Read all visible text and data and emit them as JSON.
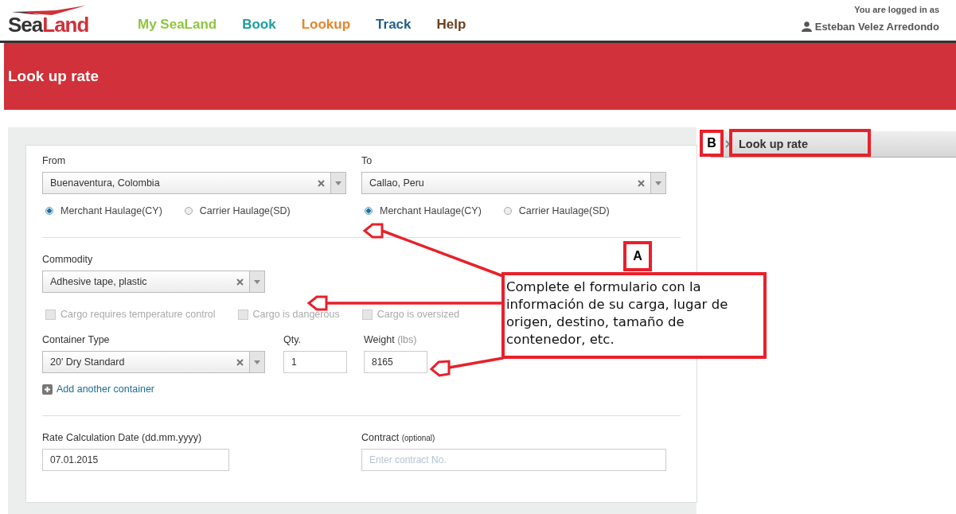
{
  "header": {
    "logo": {
      "part_1": "Sea",
      "part_2": "Land"
    },
    "nav": [
      {
        "label": "My SeaLand",
        "color": "#8dc63f"
      },
      {
        "label": "Book",
        "color": "#1a9e9e"
      },
      {
        "label": "Lookup",
        "color": "#e8822a"
      },
      {
        "label": "Track",
        "color": "#1f5f86"
      },
      {
        "label": "Help",
        "color": "#6b3e1e"
      }
    ],
    "login_caption": "You are logged in as",
    "user_name": "Esteban Velez Arredondo"
  },
  "banner": {
    "title": "Look up rate"
  },
  "form": {
    "from": {
      "label": "From",
      "value": "Buenaventura, Colombia",
      "haulage": [
        {
          "label": "Merchant Haulage(CY)",
          "selected": true
        },
        {
          "label": "Carrier Haulage(SD)",
          "selected": false
        }
      ]
    },
    "to": {
      "label": "To",
      "value": "Callao, Peru",
      "haulage": [
        {
          "label": "Merchant Haulage(CY)",
          "selected": true
        },
        {
          "label": "Carrier Haulage(SD)",
          "selected": false
        }
      ]
    },
    "commodity": {
      "label": "Commodity",
      "value": "Adhesive tape, plastic"
    },
    "cargo_options": [
      {
        "label": "Cargo requires temperature control",
        "checked": false,
        "disabled": true
      },
      {
        "label": "Cargo is dangerous",
        "checked": false,
        "disabled": true
      },
      {
        "label": "Cargo is oversized",
        "checked": false,
        "disabled": true
      }
    ],
    "container_type": {
      "label": "Container Type",
      "value": "20' Dry Standard"
    },
    "qty": {
      "label": "Qty.",
      "value": "1"
    },
    "weight": {
      "label": "Weight",
      "unit": "(lbs)",
      "value": "8165"
    },
    "add_container": "Add another container",
    "rate_date": {
      "label": "Rate Calculation Date (dd.mm.yyyy)",
      "value": "07.01.2015"
    },
    "contract": {
      "label": "Contract",
      "note": "(optional)",
      "placeholder": "Enter contract No."
    }
  },
  "sidebar": {
    "tab": "Look up rate"
  },
  "annotations": {
    "marker_a": "A",
    "callout_a": "Complete el formulario con la información de su carga, lugar de origen, destino, tamaño de contenedor, etc.",
    "marker_b": "B"
  }
}
